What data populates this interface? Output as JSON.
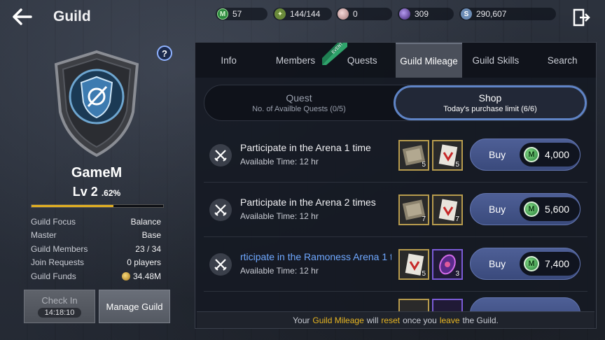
{
  "header": {
    "title": "Guild",
    "currencies": [
      {
        "icon": "mileage-coin-icon",
        "value": "57"
      },
      {
        "icon": "stamina-icon",
        "value": "144/144"
      },
      {
        "icon": "pearl-icon",
        "value": "0"
      },
      {
        "icon": "purple-gem-icon",
        "value": "309"
      },
      {
        "icon": "silver-icon",
        "value": "290,607"
      }
    ]
  },
  "guild": {
    "name": "GameM",
    "level": "Lv 2",
    "level_pct": ".62%",
    "xp_progress": 0.62,
    "stats": [
      {
        "label": "Guild Focus",
        "value": "Balance"
      },
      {
        "label": "Master",
        "value": "Base"
      },
      {
        "label": "Guild Members",
        "value": "23 / 34"
      },
      {
        "label": "Join Requests",
        "value": "0 players"
      },
      {
        "label": "Guild Funds",
        "value": "34.48M"
      }
    ],
    "checkin_label": "Check In",
    "checkin_timer": "14:18:10",
    "manage_label": "Manage Guild",
    "help_label": "?"
  },
  "tabs": [
    {
      "label": "Info"
    },
    {
      "label": "Members"
    },
    {
      "label": "Quests",
      "badge": "EVENT"
    },
    {
      "label": "Guild Mileage"
    },
    {
      "label": "Guild Skills"
    },
    {
      "label": "Search"
    }
  ],
  "subtabs": {
    "quest": {
      "title": "Quest",
      "subtitle": "No. of Availble Quests (0/5)"
    },
    "shop": {
      "title": "Shop",
      "subtitle": "Today's purchase limit (6/6)"
    }
  },
  "quests": [
    {
      "title": "Participate in the Arena 1 time",
      "time": "Available Time: 12 hr",
      "rewards": [
        {
          "type": "stone",
          "count": "5"
        },
        {
          "type": "scroll",
          "count": "5"
        }
      ],
      "buy_label": "Buy",
      "price": "4,000"
    },
    {
      "title": "Participate in the Arena 2 times",
      "time": "Available Time: 12 hr",
      "rewards": [
        {
          "type": "stone",
          "count": "7"
        },
        {
          "type": "scroll",
          "count": "7"
        }
      ],
      "buy_label": "Buy",
      "price": "5,600"
    },
    {
      "title": "rticipate in the Ramoness Arena 1 t",
      "time": "Available Time: 12 hr",
      "rewards": [
        {
          "type": "scroll",
          "count": "5"
        },
        {
          "type": "gem",
          "count": "3"
        }
      ],
      "buy_label": "Buy",
      "price": "7,400"
    }
  ],
  "footer": {
    "pre": "Your",
    "mileage": "Guild Mileage",
    "mid1": "will",
    "reset": "reset",
    "mid2": "once you",
    "leave": "leave",
    "post": "the Guild."
  },
  "colors": {
    "accent_gold": "#e3b021",
    "active_border": "#5f84c6",
    "link_blue": "#6fa8ff"
  }
}
